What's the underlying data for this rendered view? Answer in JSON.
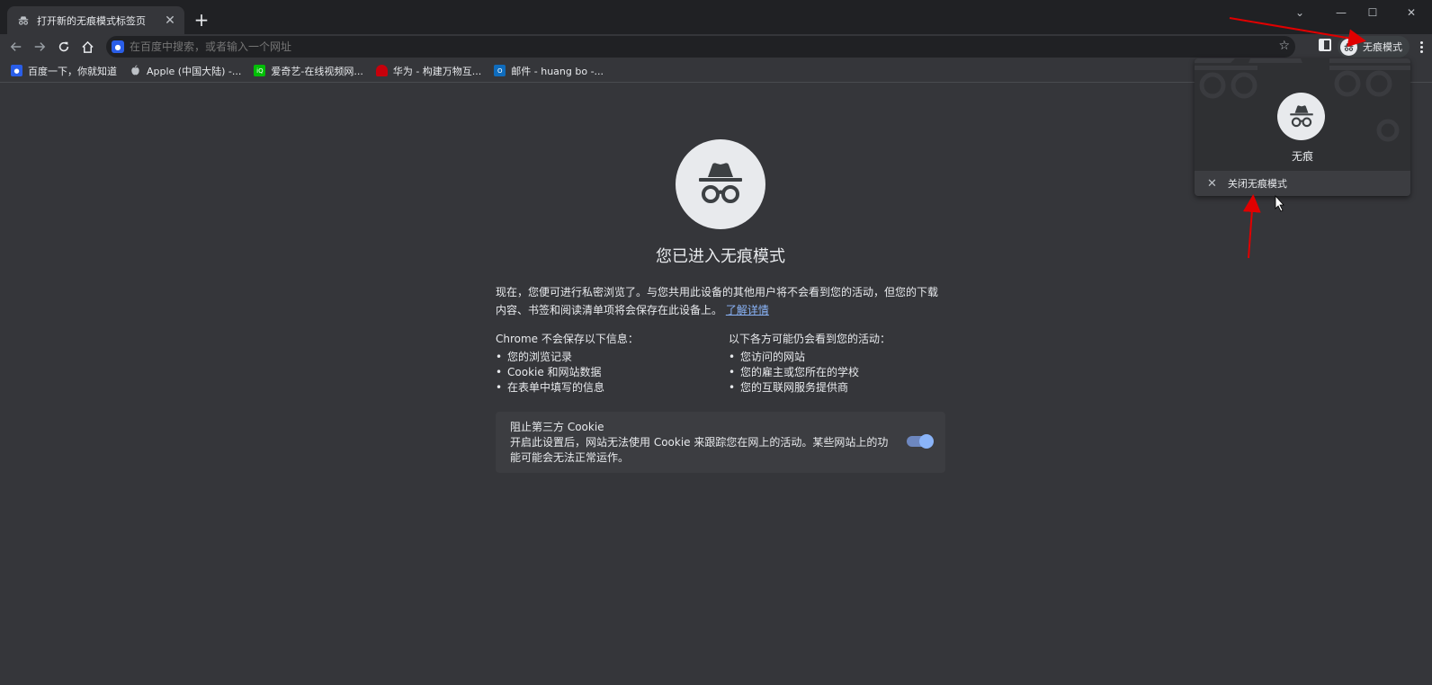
{
  "window": {
    "tab_title": "打开新的无痕模式标签页",
    "tab_close": "✕",
    "new_tab": "+",
    "minimize": "—",
    "maximize": "☐",
    "close": "✕",
    "collapse": "⌄"
  },
  "toolbar": {
    "omnibox_placeholder": "在百度中搜索，或者输入一个网址",
    "profile_label": "无痕模式"
  },
  "bookmarks": [
    {
      "label": "百度一下，你就知道",
      "color": "#2a5ee8",
      "icon": "baidu-icon"
    },
    {
      "label": "Apple (中国大陆) -...",
      "color": "#35363a",
      "icon": "apple-icon"
    },
    {
      "label": "爱奇艺-在线视频网...",
      "color": "#00be06",
      "icon": "iqiyi-icon"
    },
    {
      "label": "华为 - 构建万物互...",
      "color": "#c7000b",
      "icon": "huawei-icon"
    },
    {
      "label": "邮件 - huang bo -...",
      "color": "#0f6cbd",
      "icon": "outlook-icon"
    }
  ],
  "main": {
    "title": "您已进入无痕模式",
    "intro": "现在，您便可进行私密浏览了。与您共用此设备的其他用户将不会看到您的活动，但您的下载内容、书签和阅读清单项将会保存在此设备上。",
    "learn_more": "了解详情",
    "not_saved": {
      "heading": "Chrome 不会保存以下信息：",
      "items": [
        "您的浏览记录",
        "Cookie 和网站数据",
        "在表单中填写的信息"
      ]
    },
    "may_see": {
      "heading": "以下各方可能仍会看到您的活动：",
      "items": [
        "您访问的网站",
        "您的雇主或您所在的学校",
        "您的互联网服务提供商"
      ]
    },
    "cookie": {
      "title": "阻止第三方 Cookie",
      "desc": "开启此设置后，网站无法使用 Cookie 来跟踪您在网上的活动。某些网站上的功能可能会无法正常运作。",
      "toggle_on": true
    }
  },
  "popup": {
    "name": "无痕",
    "close_label": "关闭无痕模式",
    "close_icon": "✕"
  },
  "colors": {
    "accent": "#8ab4f8",
    "annotation_arrow": "#e00000"
  }
}
